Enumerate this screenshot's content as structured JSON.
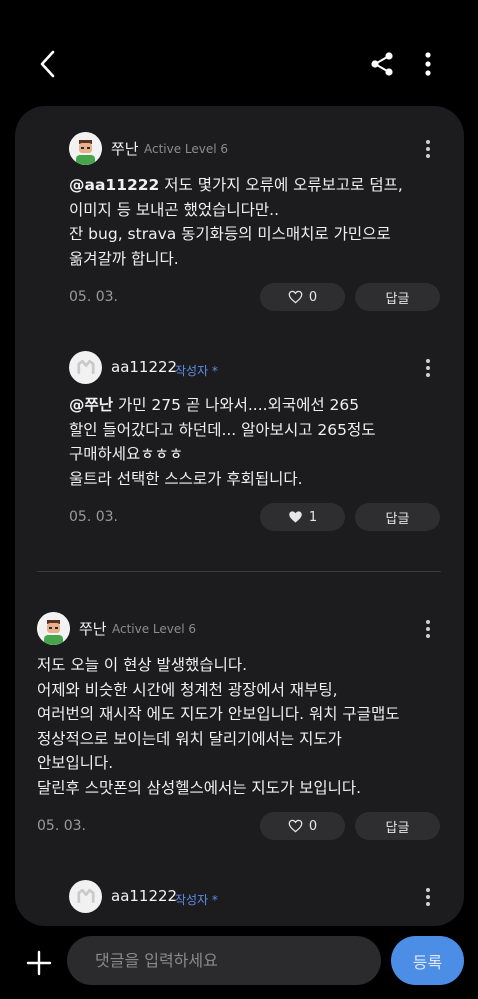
{
  "comments": [
    {
      "username": "쭈난",
      "level": "Active Level 6",
      "mention": "@aa11222",
      "text": " 저도 몇가지 오류에 오류보고로 덤프,\n이미지 등 보내곤 했었습니다만..\n잔 bug, strava 동기화등의 미스매치로 가민으로\n옮겨갈까 합니다.",
      "date": "05. 03.",
      "likes": "0",
      "liked": false,
      "reply_label": "답글"
    },
    {
      "username": "aa11222",
      "author_tag": "작성자 *",
      "mention": "@쭈난",
      "text": "  가민 275 곧 나와서....외국에선 265\n할인 들어갔다고 하던데... 알아보시고 265정도\n구매하세요ㅎㅎㅎ\n울트라 선택한 스스로가 후회됩니다.",
      "date": "05. 03.",
      "likes": "1",
      "liked": true,
      "reply_label": "답글"
    },
    {
      "username": "쭈난",
      "level": "Active Level 6",
      "text": "저도 오늘 이 현상 발생했습니다.\n어제와 비슷한 시간에 청계천 광장에서 재부팅,\n여러번의 재시작 에도 지도가 안보입니다. 워치 구글맵도\n정상적으로 보이는데 워치 달리기에서는 지도가\n안보입니다.\n달린후 스맛폰의 삼성헬스에서는 지도가 보입니다.",
      "date": "05. 03.",
      "likes": "0",
      "liked": false,
      "reply_label": "답글"
    },
    {
      "username": "aa11222",
      "author_tag": "작성자 *"
    }
  ],
  "composer": {
    "placeholder": "댓글을 입력하세요",
    "submit_label": "등록"
  },
  "colors": {
    "accent": "#4c8de6",
    "card_bg": "#1c1c1e",
    "pill_bg": "#2e2e30"
  }
}
